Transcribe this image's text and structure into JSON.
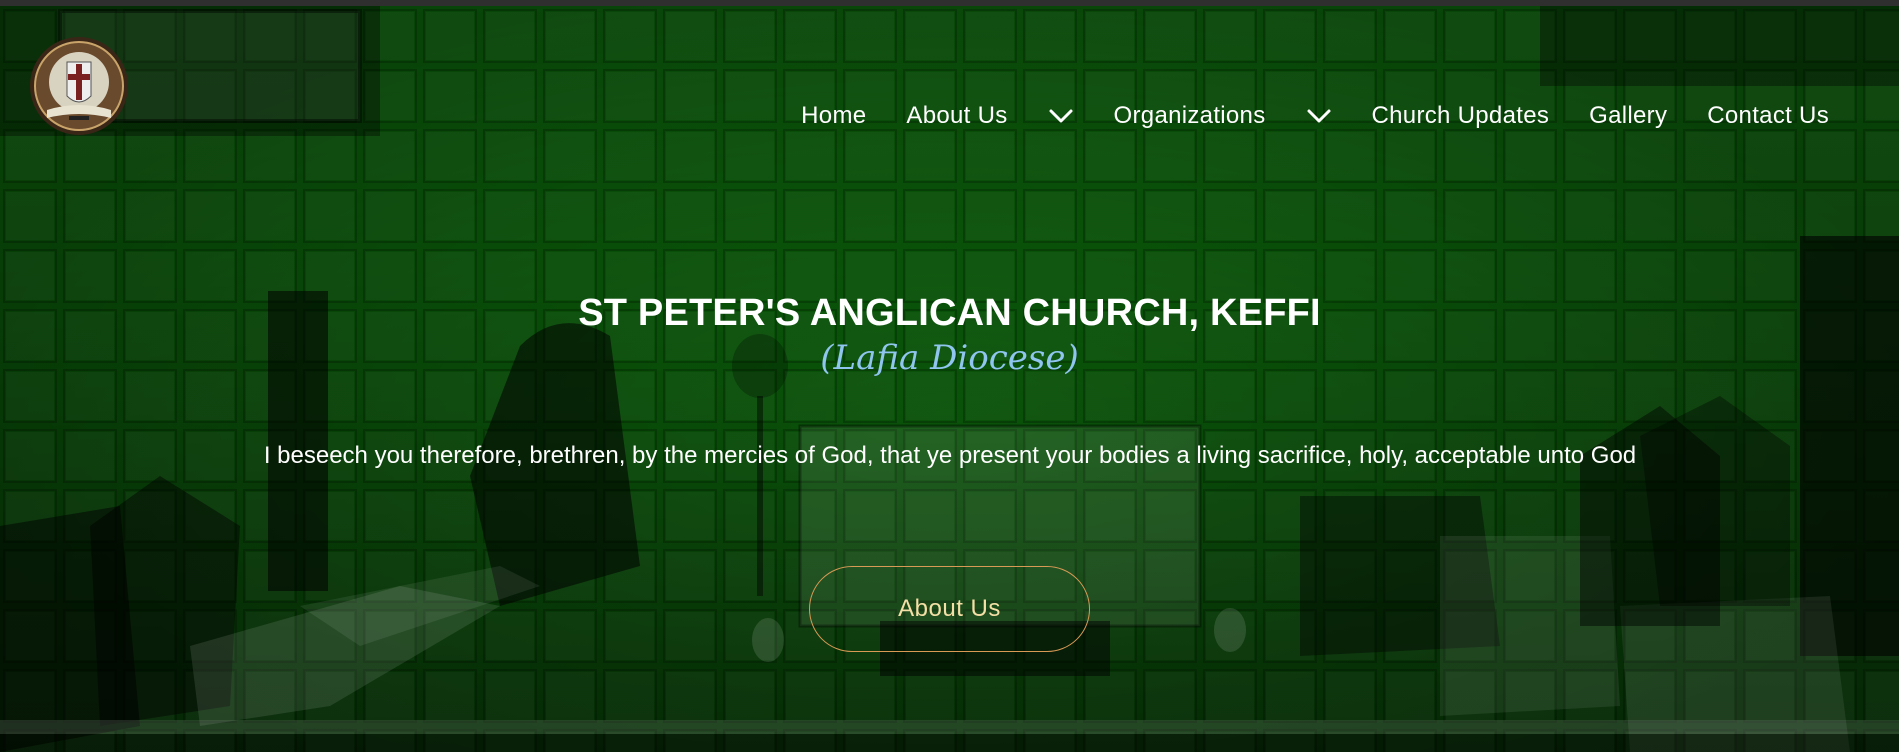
{
  "header": {
    "logo_icon": "church-seal-logo",
    "nav": {
      "home": "Home",
      "about_us": "About Us",
      "organizations": "Organizations",
      "church_updates": "Church Updates",
      "gallery": "Gallery",
      "contact_us": "Contact Us"
    },
    "dropdown_icon": "chevron-down-icon"
  },
  "hero": {
    "title": "ST PETER'S ANGLICAN CHURCH, KEFFI",
    "subtitle": "(Lafia Diocese)",
    "verse": "I beseech you therefore, brethren, by the mercies of God, that ye present your bodies a living sacrifice, holy, acceptable unto God",
    "cta_label": "About Us"
  },
  "colors": {
    "overlay_green": "#0a5d0a",
    "title_white": "#ffffff",
    "subtitle_blue": "#8fc5ef",
    "cta_border": "#d89a55",
    "cta_text": "#f4dfa6"
  }
}
